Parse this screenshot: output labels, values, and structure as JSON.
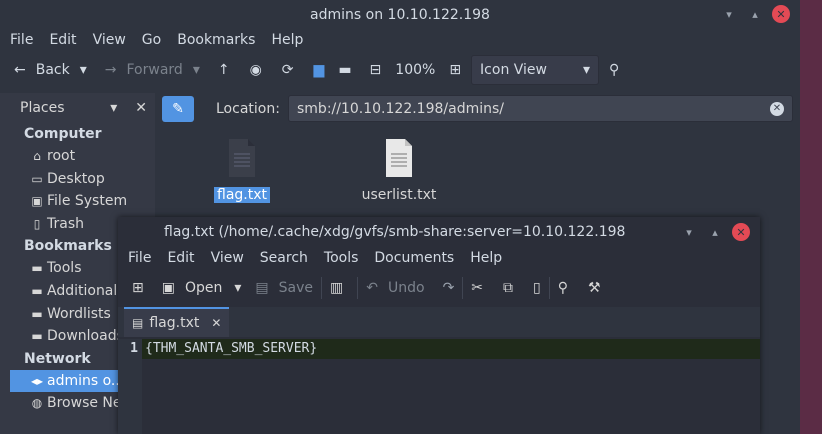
{
  "fm": {
    "title": "admins on 10.10.122.198",
    "menu": [
      "File",
      "Edit",
      "View",
      "Go",
      "Bookmarks",
      "Help"
    ],
    "back_label": "Back",
    "forward_label": "Forward",
    "zoom": "100%",
    "view_mode": "Icon View",
    "places_label": "Places",
    "location_label": "Location:",
    "location_value": "smb://10.10.122.198/admins/",
    "sidebar": {
      "computer": "Computer",
      "computer_items": [
        "root",
        "Desktop",
        "File System",
        "Trash"
      ],
      "bookmarks": "Bookmarks",
      "bookmark_items": [
        "Tools",
        "Additional",
        "Wordlists",
        "Downloads"
      ],
      "network": "Network",
      "network_items": [
        "admins o...",
        "Browse Ne"
      ]
    },
    "files": [
      "flag.txt",
      "userlist.txt"
    ]
  },
  "editor": {
    "title": "flag.txt (/home/.cache/xdg/gvfs/smb-share:server=10.10.122.198",
    "menu": [
      "File",
      "Edit",
      "View",
      "Search",
      "Tools",
      "Documents",
      "Help"
    ],
    "open_label": "Open",
    "save_label": "Save",
    "undo_label": "Undo",
    "tab_label": "flag.txt",
    "line_number": "1",
    "content": "{THM_SANTA_SMB_SERVER}"
  }
}
